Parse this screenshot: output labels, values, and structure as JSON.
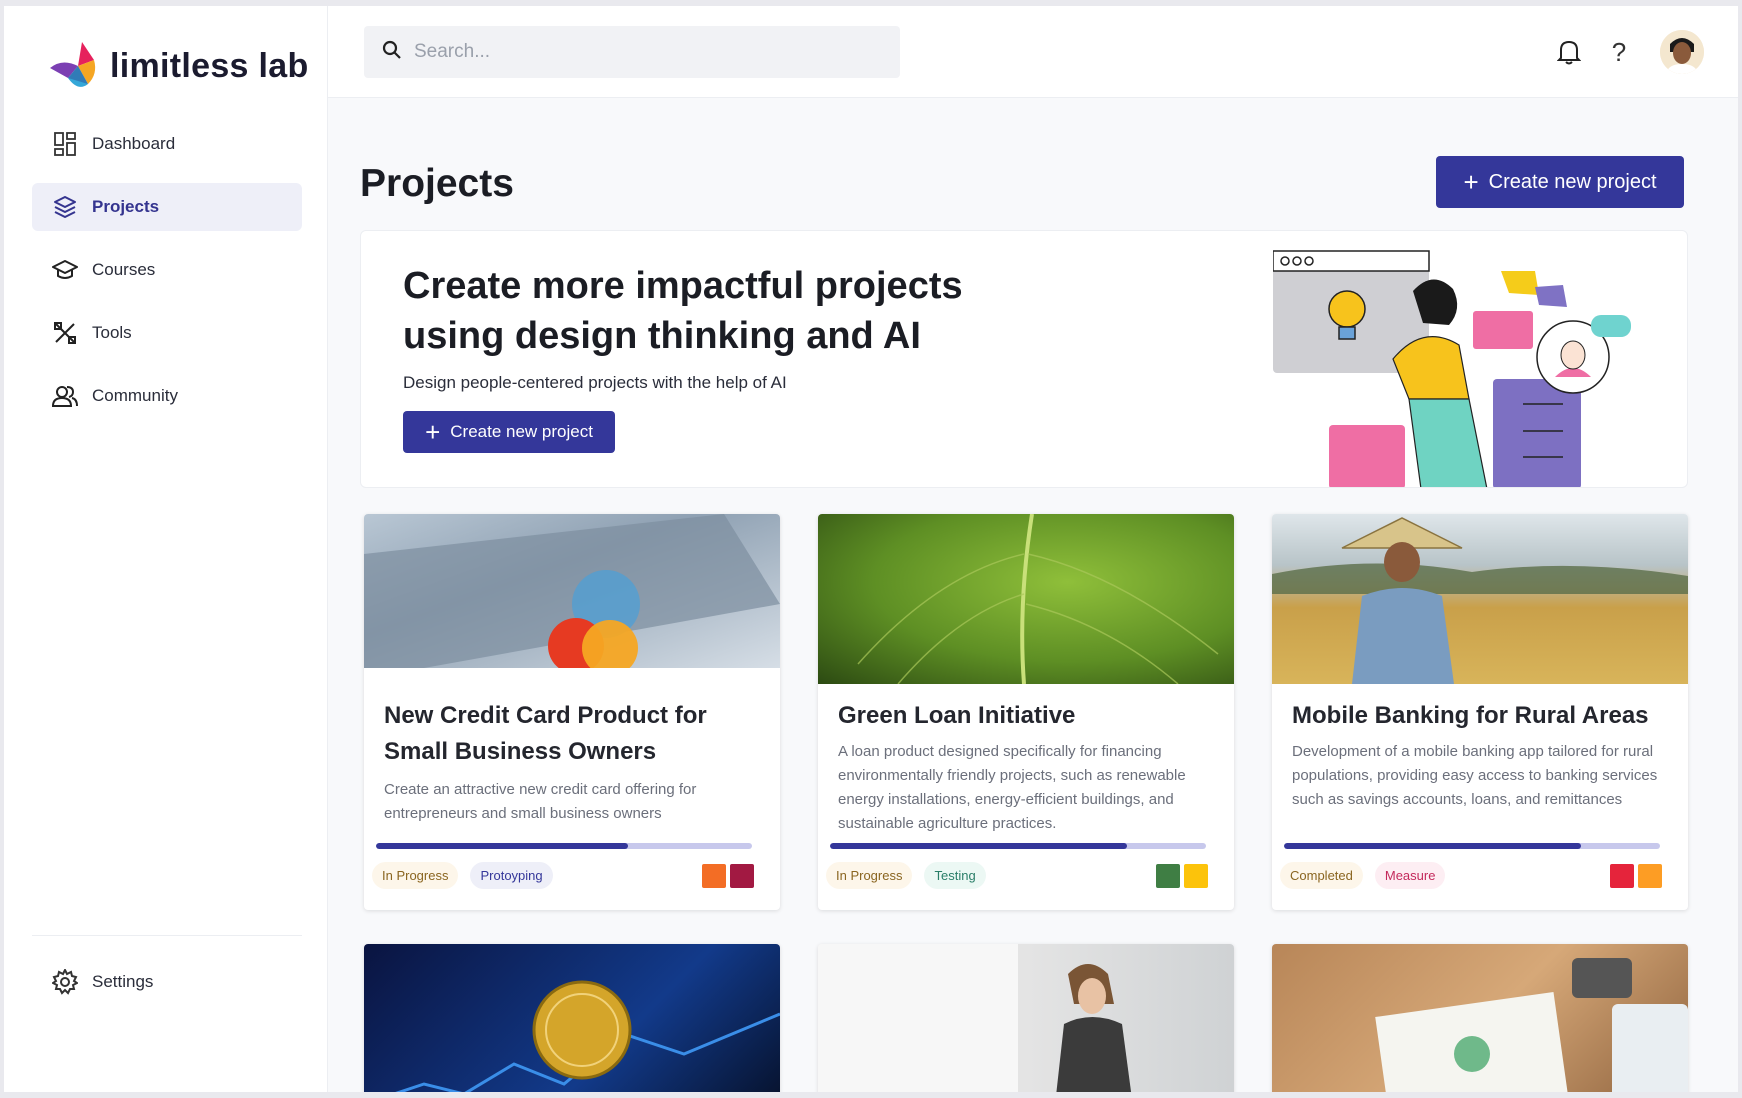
{
  "app": {
    "name": "limitless lab"
  },
  "sidebar": {
    "items": [
      {
        "label": "Dashboard",
        "icon": "dashboard-icon"
      },
      {
        "label": "Projects",
        "icon": "layers-icon",
        "active": true
      },
      {
        "label": "Courses",
        "icon": "graduation-cap-icon"
      },
      {
        "label": "Tools",
        "icon": "tools-icon"
      },
      {
        "label": "Community",
        "icon": "users-icon"
      }
    ],
    "settings_label": "Settings"
  },
  "search": {
    "placeholder": "Search..."
  },
  "header": {
    "title": "Projects",
    "create_label": "Create new project"
  },
  "hero": {
    "title": "Create more impactful projects using design thinking and AI",
    "subtitle": "Design people-centered projects with the help of AI",
    "button_label": "Create new project"
  },
  "projects": [
    {
      "title": "New Credit Card Product for Small Business Owners",
      "description": "Create an attractive new credit card offering for entrepreneurs and small business owners",
      "progress": 0.67,
      "status": "In Progress",
      "stage": "Protoyping",
      "sdg_colors": [
        "#f36d25",
        "#a21942"
      ]
    },
    {
      "title": "Green Loan Initiative",
      "description": " A loan product designed specifically for financing environmentally friendly projects, such as renewable energy installations, energy-efficient buildings, and sustainable agriculture practices.",
      "progress": 0.79,
      "status": "In Progress",
      "stage": "Testing",
      "sdg_colors": [
        "#3f7e44",
        "#fcc30b"
      ]
    },
    {
      "title": "Mobile Banking for Rural Areas",
      "description": "Development of a mobile banking app tailored for rural populations, providing easy access to banking services such as savings accounts, loans, and remittances",
      "progress": 0.79,
      "status": "Completed",
      "stage": "Measure",
      "sdg_colors": [
        "#e5243b",
        "#fd9d24"
      ]
    }
  ],
  "colors": {
    "primary": "#34379a",
    "progress_track": "#c7c8ec"
  }
}
